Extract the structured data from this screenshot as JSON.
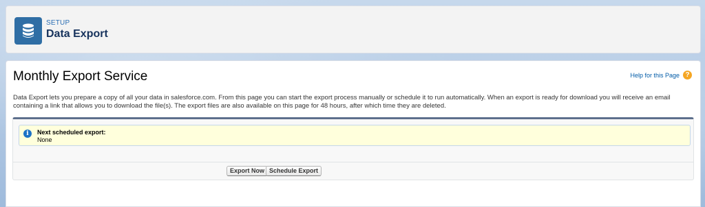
{
  "header": {
    "eyebrow": "SETUP",
    "title": "Data Export",
    "icon": "database-icon",
    "icon_color": "#2f6ea5"
  },
  "main": {
    "title": "Monthly Export Service",
    "help_label": "Help for this Page",
    "description": "Data Export lets you prepare a copy of all your data in salesforce.com. From this page you can start the export process manually or schedule it to run automatically. When an export is ready for download you will receive an email containing a link that allows you to download the file(s). The export files are also available on this page for 48 hours, after which time they are deleted."
  },
  "info": {
    "title": "Next scheduled export:",
    "value": "None"
  },
  "buttons": {
    "export_now": "Export Now",
    "schedule_export": "Schedule Export"
  }
}
